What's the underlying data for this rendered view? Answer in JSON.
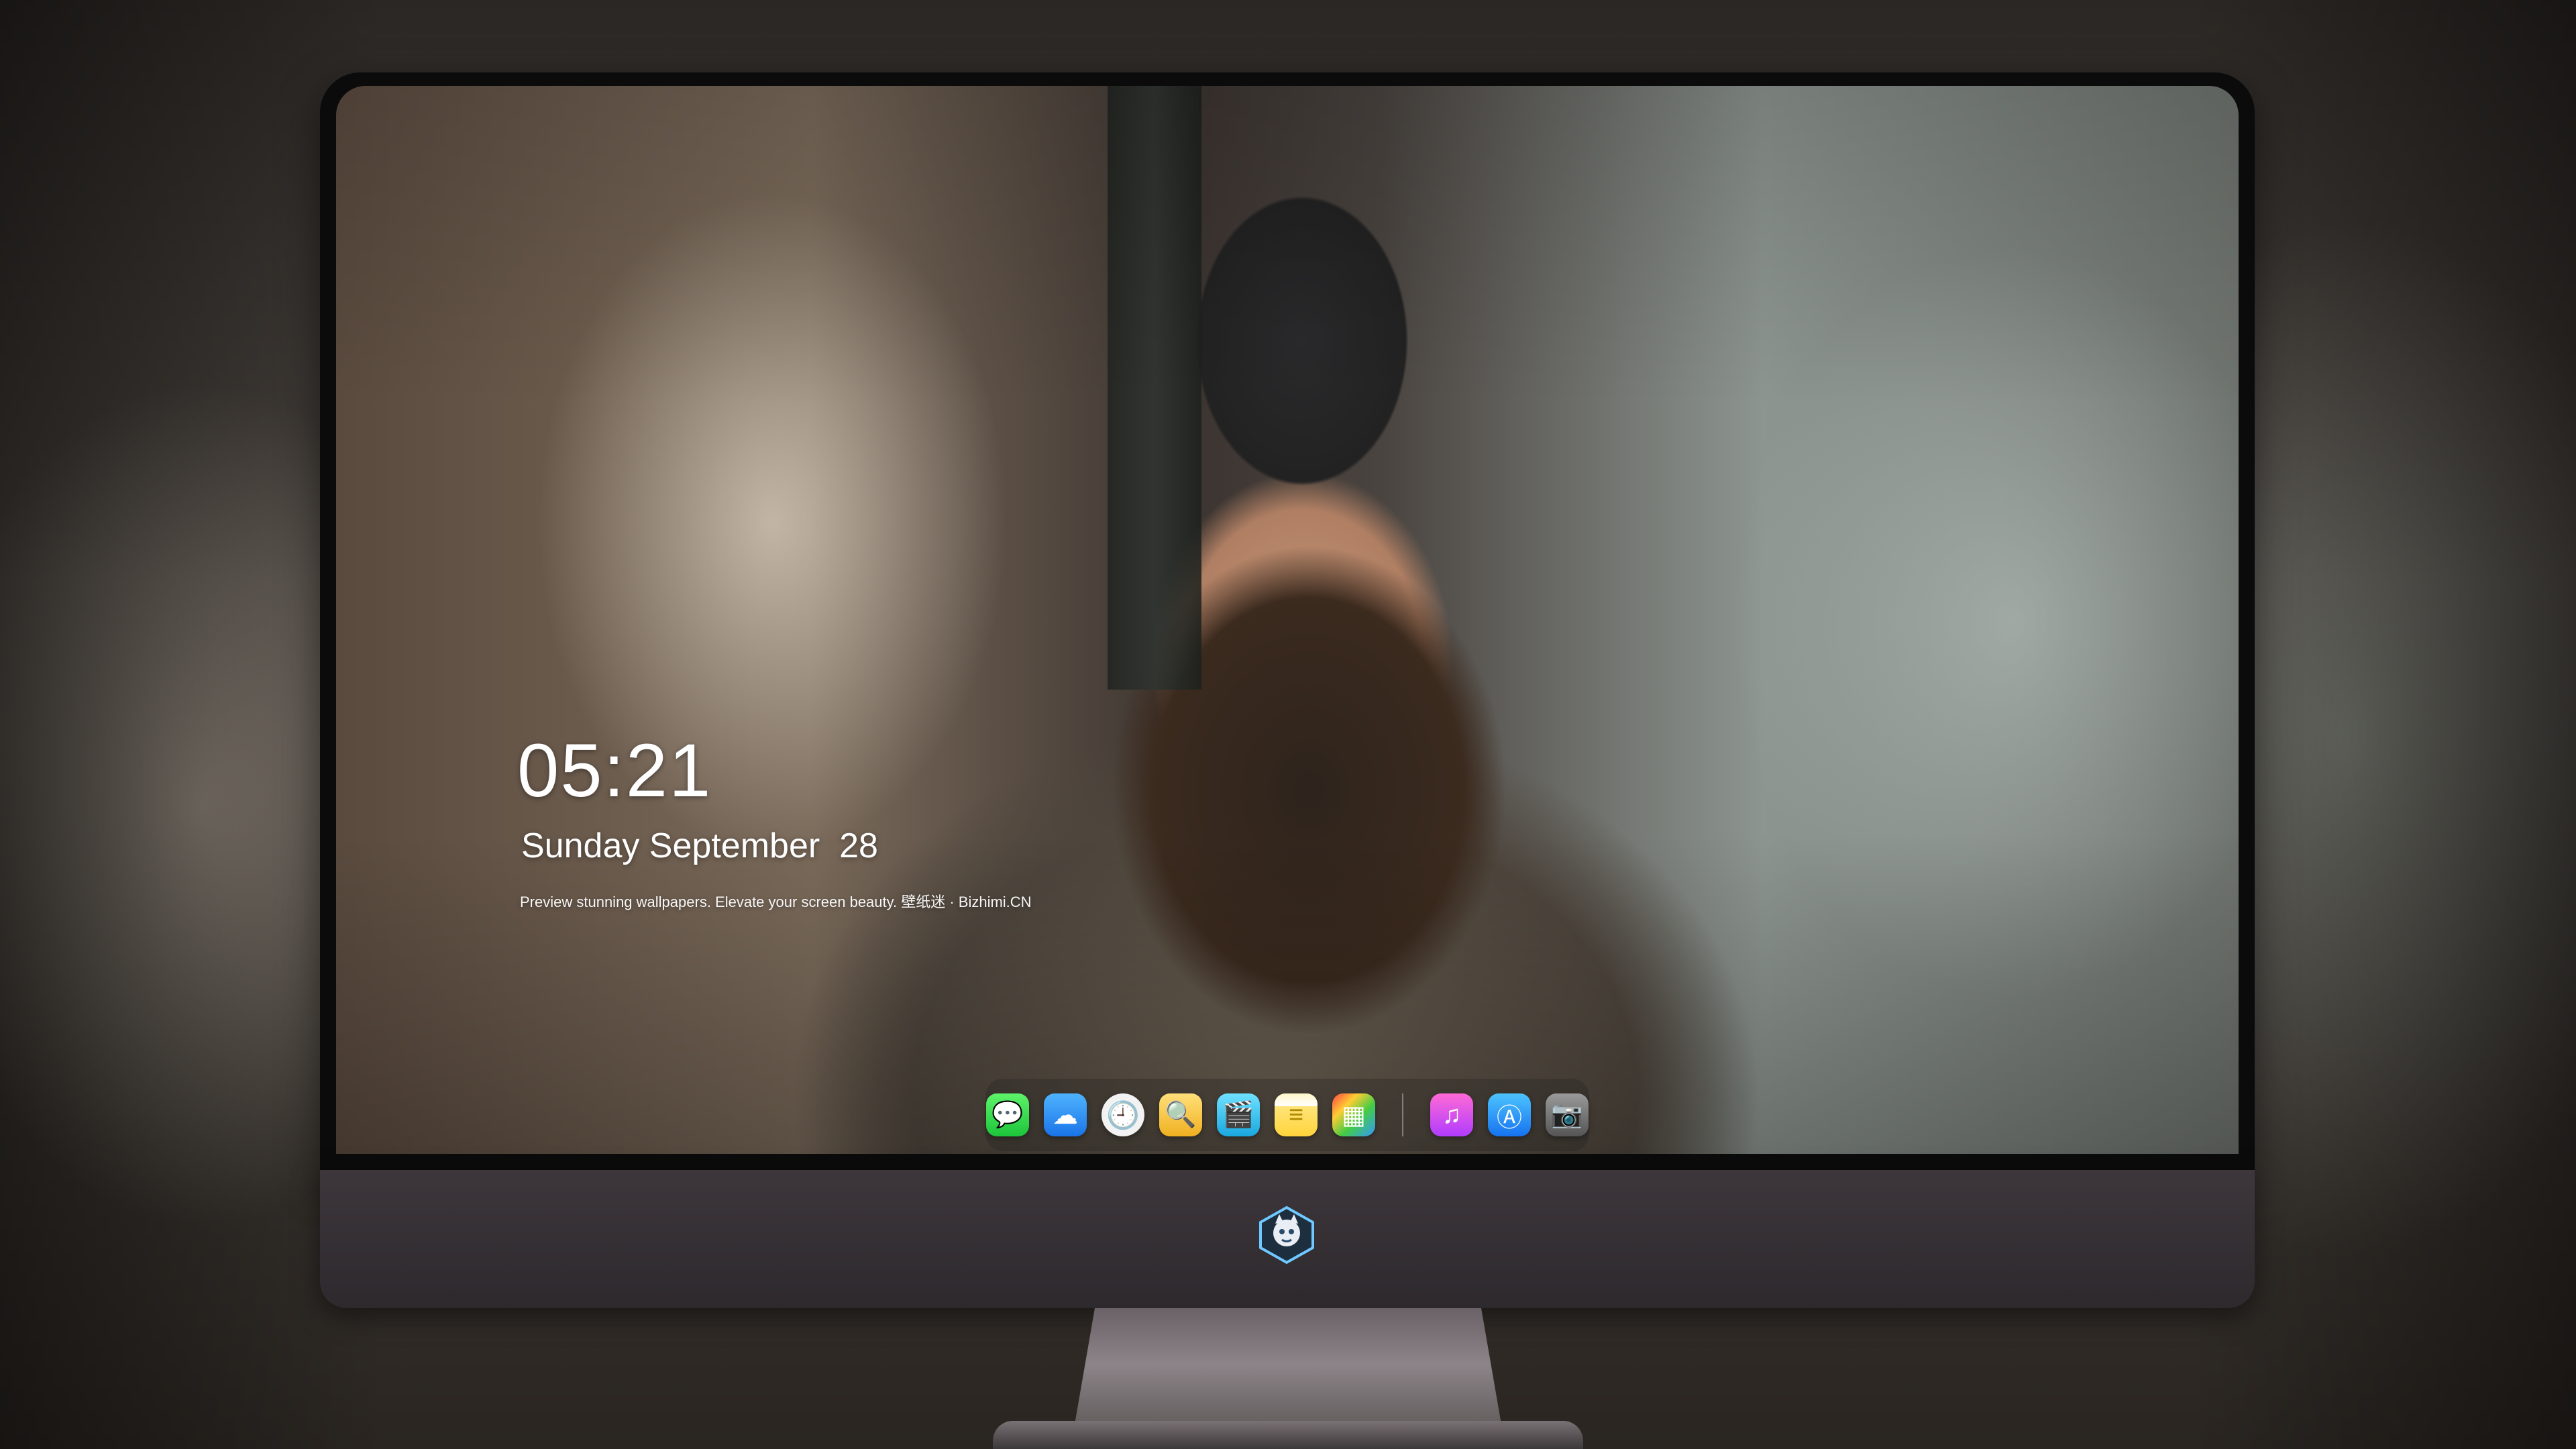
{
  "lockscreen": {
    "time": "05:21",
    "date": "Sunday September  28",
    "tagline": "Preview stunning wallpapers. Elevate your screen beauty. 壁纸迷 · Bizhimi.CN"
  },
  "dock": {
    "apps": [
      {
        "name": "messages-icon",
        "glyph": "💬"
      },
      {
        "name": "weather-icon",
        "glyph": "☁"
      },
      {
        "name": "clock-icon",
        "glyph": "🕘"
      },
      {
        "name": "preview-icon",
        "glyph": "🔍"
      },
      {
        "name": "clips-icon",
        "glyph": "🎬"
      },
      {
        "name": "notes-icon",
        "glyph": "≡"
      },
      {
        "name": "photos-icon",
        "glyph": "▦"
      },
      {
        "name": "music-icon",
        "glyph": "♫"
      },
      {
        "name": "app-store-icon",
        "glyph": "Ⓐ"
      },
      {
        "name": "camera-icon",
        "glyph": "📷"
      }
    ]
  },
  "colors": {
    "chin": "#3d373c",
    "bezel": "#0b0b0c",
    "clock_text": "#ffffff"
  }
}
